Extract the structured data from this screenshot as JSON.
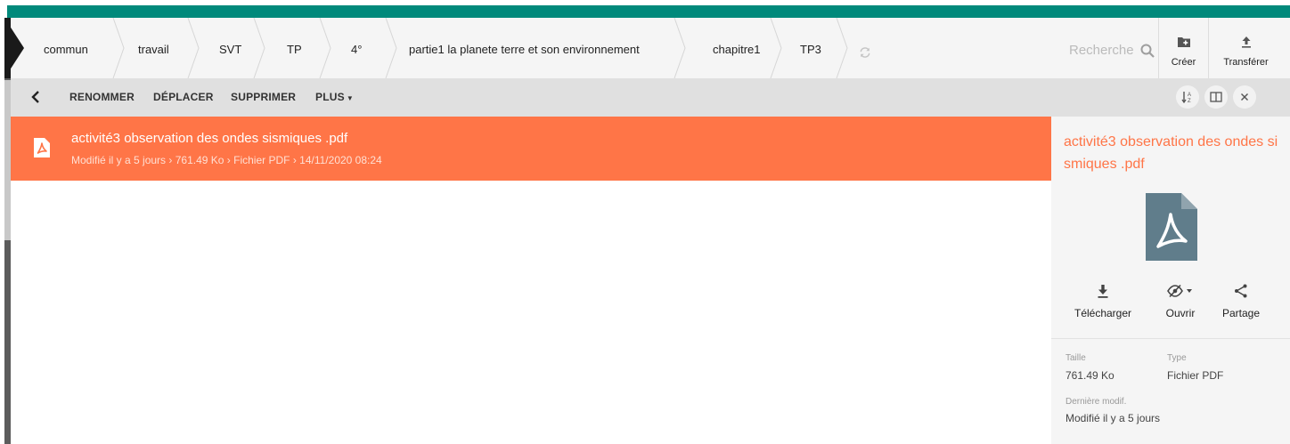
{
  "breadcrumbs": [
    "commun",
    "travail",
    "SVT",
    "TP",
    "4°",
    "partie1 la planete terre et son environnement",
    "chapitre1",
    "TP3"
  ],
  "search": {
    "placeholder": "Recherche"
  },
  "header_actions": {
    "create_label": "Créer",
    "upload_label": "Transférer"
  },
  "toolbar": {
    "rename_label": "RENOMMER",
    "move_label": "DÉPLACER",
    "delete_label": "SUPPRIMER",
    "more_label": "PLUS"
  },
  "file": {
    "name": "activité3 observation des ondes sismiques .pdf",
    "modified": "Modifié il y a 5 jours",
    "size": "761.49 Ko",
    "type": "Fichier PDF",
    "date": "14/11/2020 08:24"
  },
  "panel": {
    "title": "activité3 observation des ondes sismiques .pdf",
    "download_label": "Télécharger",
    "open_label": "Ouvrir",
    "share_label": "Partage",
    "size_label": "Taille",
    "size_value": "761.49 Ko",
    "type_label": "Type",
    "type_value": "Fichier PDF",
    "modified_label": "Dernière modif.",
    "modified_value": "Modifié il y a 5 jours"
  },
  "colors": {
    "accent": "#ff7547",
    "brand": "#00897b",
    "pdf_icon": "#607d8b"
  },
  "icons": [
    "refresh-icon",
    "search-icon",
    "folder-plus-icon",
    "upload-icon",
    "back-icon",
    "sort-icon",
    "split-view-icon",
    "close-icon",
    "pdf-icon",
    "download-icon",
    "eye-off-icon",
    "share-icon"
  ]
}
